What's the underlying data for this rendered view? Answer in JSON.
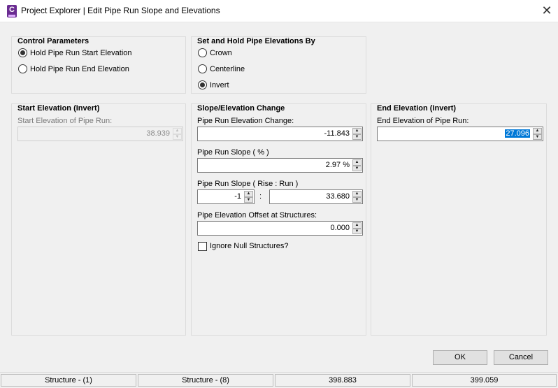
{
  "window": {
    "title": "Project Explorer | Edit Pipe Run Slope and Elevations",
    "app_icon": "civil3d-app-icon",
    "close_glyph": "✕"
  },
  "control_parameters": {
    "title": "Control Parameters",
    "options": [
      {
        "label": "Hold Pipe Run Start Elevation",
        "checked": true
      },
      {
        "label": "Hold Pipe Run End Elevation",
        "checked": false
      }
    ]
  },
  "hold_elevations": {
    "title": "Set and Hold Pipe Elevations By",
    "options": [
      {
        "label": "Crown",
        "checked": false
      },
      {
        "label": "Centerline",
        "checked": false
      },
      {
        "label": "Invert",
        "checked": true
      }
    ]
  },
  "start_elevation": {
    "title": "Start Elevation (Invert)",
    "field_label": "Start Elevation of Pipe Run:",
    "value": "38.939"
  },
  "slope_change": {
    "title": "Slope/Elevation Change",
    "elev_change_label": "Pipe Run Elevation Change:",
    "elev_change_value": "-11.843",
    "slope_pct_label": "Pipe Run Slope ( % )",
    "slope_pct_value": "2.97 %",
    "slope_ratio_label": "Pipe Run Slope ( Rise : Run )",
    "rise_value": "-1",
    "ratio_separator": ":",
    "run_value": "33.680",
    "offset_label": "Pipe Elevation Offset at Structures:",
    "offset_value": "0.000",
    "ignore_null_label": "Ignore Null Structures?",
    "ignore_null_checked": false
  },
  "end_elevation": {
    "title": "End Elevation (Invert)",
    "field_label": "End Elevation of Pipe Run:",
    "value": "27.096"
  },
  "buttons": {
    "ok": "OK",
    "cancel": "Cancel"
  },
  "status_bar": [
    "Structure - (1)",
    "Structure - (8)",
    "398.883",
    "399.059"
  ],
  "spinner_glyphs": {
    "up": "▲",
    "down": "▼"
  }
}
